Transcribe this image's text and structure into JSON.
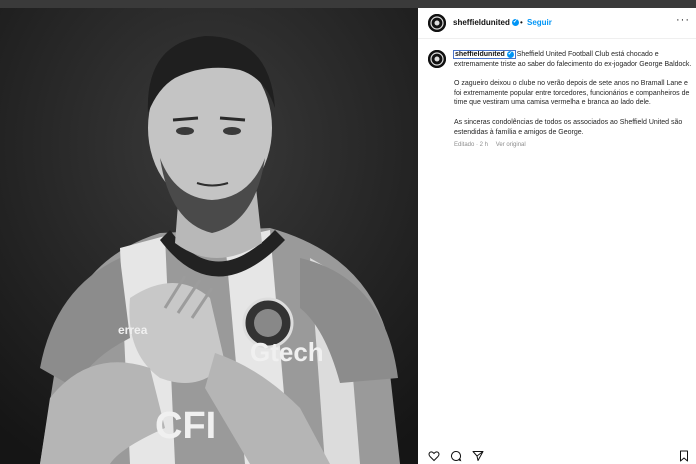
{
  "post": {
    "username": "sheffieldunited",
    "dot": "•",
    "follow_label": "Seguir",
    "more_label": "···",
    "verified_mark": "✓",
    "caption_intro": " Sheffield United Football Club está chocado e extremamente triste ao saber do falecimento do ex-jogador George Baldock.",
    "caption_p2": "O zagueiro deixou o clube no verão depois de sete anos no Bramall Lane e foi extremamente popular entre torcedores, funcionários e companheiros de time que vestiram uma camisa vermelha e branca ao lado dele.",
    "caption_p3": "As sinceras condolências de todos os associados ao Sheffield United são estendidas à família e amigos de George.",
    "edited_label": "Editado · 2 h",
    "translate_label": "Ver original"
  },
  "photo": {
    "shirt_sponsor": "CFI",
    "sleeve_sponsor": "Gtech",
    "kit_brand": "errea"
  },
  "icons": {
    "like": "heart-icon",
    "comment": "comment-icon",
    "share": "share-icon",
    "save": "bookmark-icon"
  },
  "colors": {
    "link": "#0095f6",
    "verified": "#0095f6",
    "text": "#262626",
    "muted": "#8e8e8e"
  }
}
